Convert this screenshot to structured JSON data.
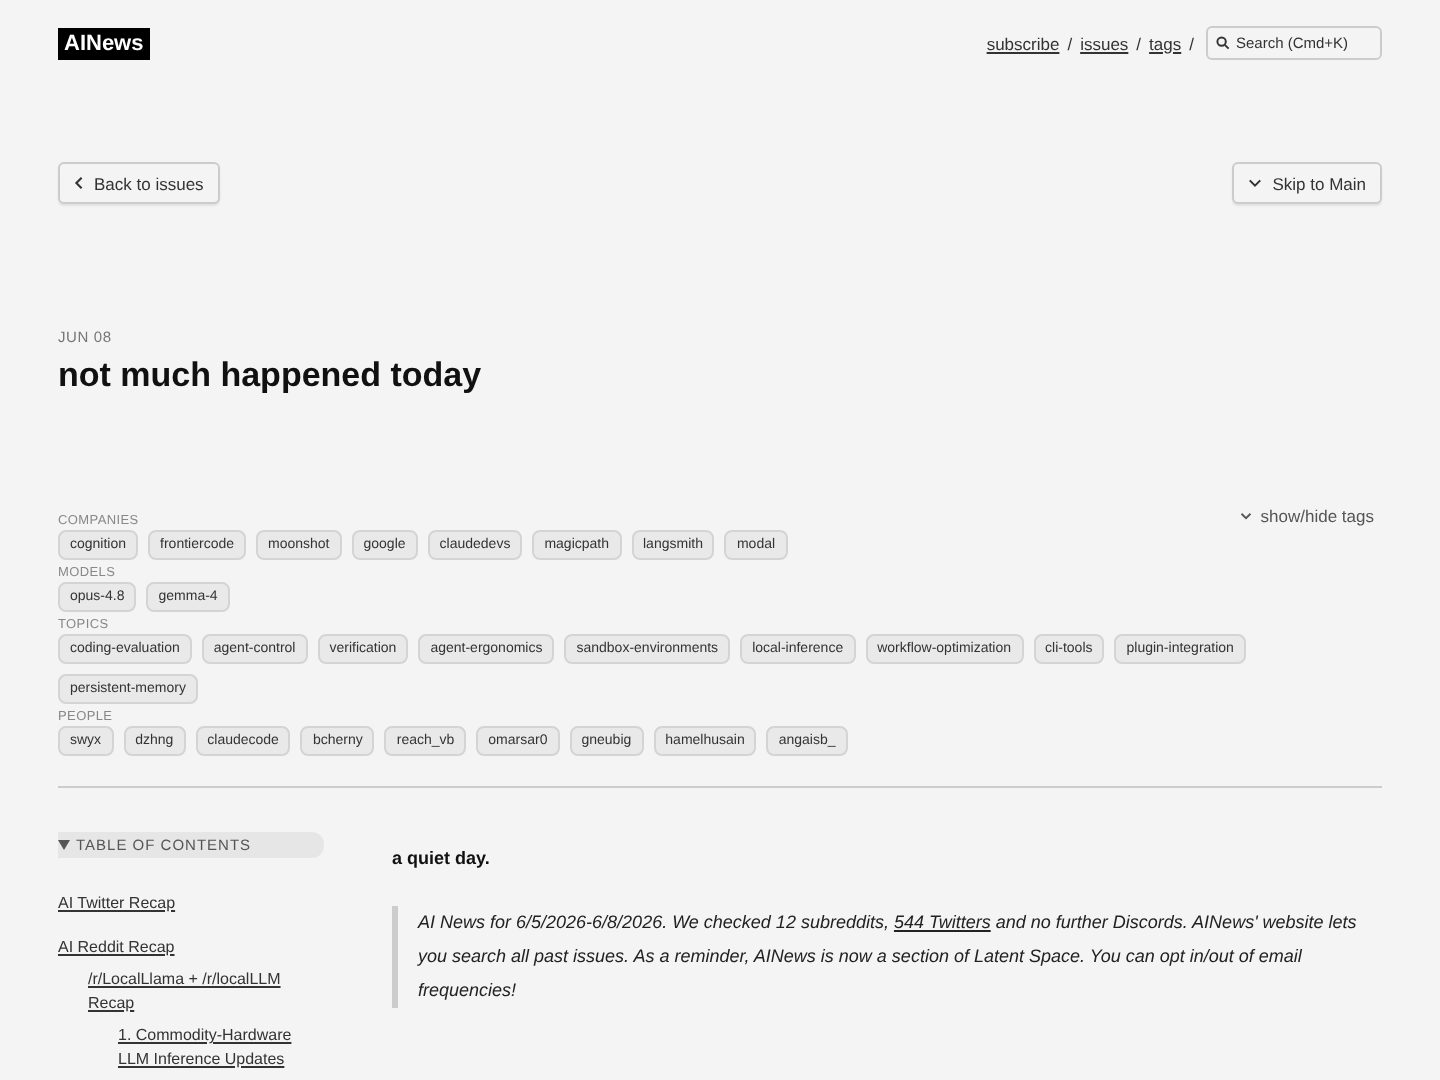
{
  "header": {
    "logo": "AINews",
    "links": [
      "subscribe",
      "issues",
      "tags"
    ],
    "separator": "/",
    "search": {
      "placeholder": "Search (Cmd+K)"
    }
  },
  "nav": {
    "back": "Back to issues",
    "skip": "Skip to Main"
  },
  "issue": {
    "date": "JUN 08",
    "title": "not much happened today"
  },
  "tags": {
    "toggle": "show/hide tags",
    "groups": [
      {
        "label": "COMPANIES",
        "tags": [
          "cognition",
          "frontiercode",
          "moonshot",
          "google",
          "claudedevs",
          "magicpath",
          "langsmith",
          "modal"
        ]
      },
      {
        "label": "MODELS",
        "tags": [
          "opus-4.8",
          "gemma-4"
        ]
      },
      {
        "label": "TOPICS",
        "tags": [
          "coding-evaluation",
          "agent-control",
          "verification",
          "agent-ergonomics",
          "sandbox-environments",
          "local-inference",
          "workflow-optimization",
          "cli-tools",
          "plugin-integration",
          "persistent-memory"
        ]
      },
      {
        "label": "PEOPLE",
        "tags": [
          "swyx",
          "dzhng",
          "claudecode",
          "bcherny",
          "reach_vb",
          "omarsar0",
          "gneubig",
          "hamelhusain",
          "angaisb_"
        ]
      }
    ]
  },
  "toc": {
    "title": "TABLE OF CONTENTS",
    "expanded": true,
    "items": [
      {
        "label": "AI Twitter Recap"
      },
      {
        "label": "AI Reddit Recap",
        "children": [
          {
            "label": "/r/LocalLlama + /r/localLLM Recap",
            "children": [
              {
                "label": "1. Commodity-Hardware LLM Inference Updates"
              }
            ]
          }
        ]
      }
    ]
  },
  "article": {
    "lead": "a quiet day.",
    "note": {
      "before": "AI News for 6/5/2026-6/8/2026. We checked 12 subreddits, ",
      "link": "544 Twitters",
      "after": " and no further Discords. AINews' website lets you search all past issues. As a reminder, AINews is now a section of Latent Space. You can opt in/out of email frequencies!"
    }
  }
}
